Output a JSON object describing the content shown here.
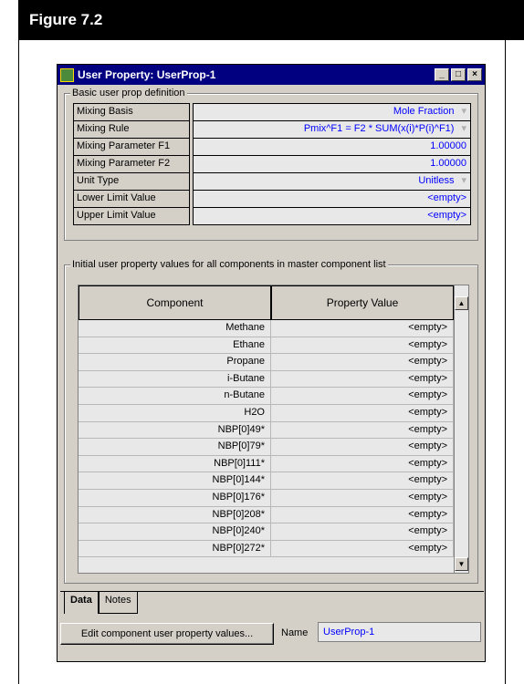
{
  "figure_label": "Figure 7.2",
  "window": {
    "title": "User Property: UserProp-1",
    "controls": [
      "minimize",
      "maximize",
      "close"
    ]
  },
  "basic_group": {
    "label": "Basic user prop definition",
    "rows": [
      {
        "name": "Mixing Basis",
        "value": "Mole Fraction",
        "dropdown": true
      },
      {
        "name": "Mixing Rule",
        "value": "Pmix^F1 = F2 * SUM(x(i)*P(i)^F1)",
        "dropdown": true
      },
      {
        "name": "Mixing Parameter F1",
        "value": "1.00000",
        "dropdown": false
      },
      {
        "name": "Mixing Parameter F2",
        "value": "1.00000",
        "dropdown": false
      },
      {
        "name": "Unit Type",
        "value": "Unitless",
        "dropdown": true
      },
      {
        "name": "Lower Limit Value",
        "value": "<empty>",
        "dropdown": false
      },
      {
        "name": "Upper Limit Value",
        "value": "<empty>",
        "dropdown": false
      }
    ]
  },
  "initial_group": {
    "label": "Initial user property values for all components in master component list",
    "columns": [
      "Component",
      "Property Value"
    ],
    "rows": [
      [
        "Methane",
        "<empty>"
      ],
      [
        "Ethane",
        "<empty>"
      ],
      [
        "Propane",
        "<empty>"
      ],
      [
        "i-Butane",
        "<empty>"
      ],
      [
        "n-Butane",
        "<empty>"
      ],
      [
        "H2O",
        "<empty>"
      ],
      [
        "NBP[0]49*",
        "<empty>"
      ],
      [
        "NBP[0]79*",
        "<empty>"
      ],
      [
        "NBP[0]111*",
        "<empty>"
      ],
      [
        "NBP[0]144*",
        "<empty>"
      ],
      [
        "NBP[0]176*",
        "<empty>"
      ],
      [
        "NBP[0]208*",
        "<empty>"
      ],
      [
        "NBP[0]240*",
        "<empty>"
      ],
      [
        "NBP[0]272*",
        "<empty>"
      ]
    ]
  },
  "tabs": [
    "Data",
    "Notes"
  ],
  "active_tab": "Data",
  "edit_button": "Edit component user property values...",
  "name_label": "Name",
  "name_value": "UserProp-1"
}
